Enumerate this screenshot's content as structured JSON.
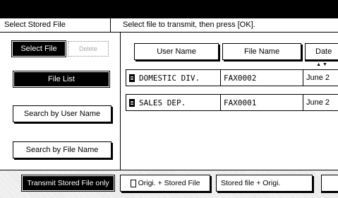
{
  "header": {
    "title": "Select Stored File",
    "instruction": "Select file to transmit, then press [OK]."
  },
  "sidebar": {
    "select_file_label": "Select File",
    "delete_label": "Delete",
    "file_list_label": "File List",
    "search_user_label": "Search by User Name",
    "search_file_label": "Search by File Name"
  },
  "table": {
    "columns": [
      "User Name",
      "File Name",
      "Date"
    ],
    "sort_indicator": "▲▼",
    "rows": [
      {
        "user": "DOMESTIC DIV.",
        "file": "FAX0002",
        "date": "June 2"
      },
      {
        "user": "SALES DEP.",
        "file": "FAX0001",
        "date": "June 2"
      }
    ]
  },
  "bottom": {
    "transmit_only_label": "Transmit Stored File only",
    "orig_stored_label": "Origi. + Stored File",
    "stored_orig_label": "Stored file + Origi.",
    "orig_icon": "document-icon"
  }
}
